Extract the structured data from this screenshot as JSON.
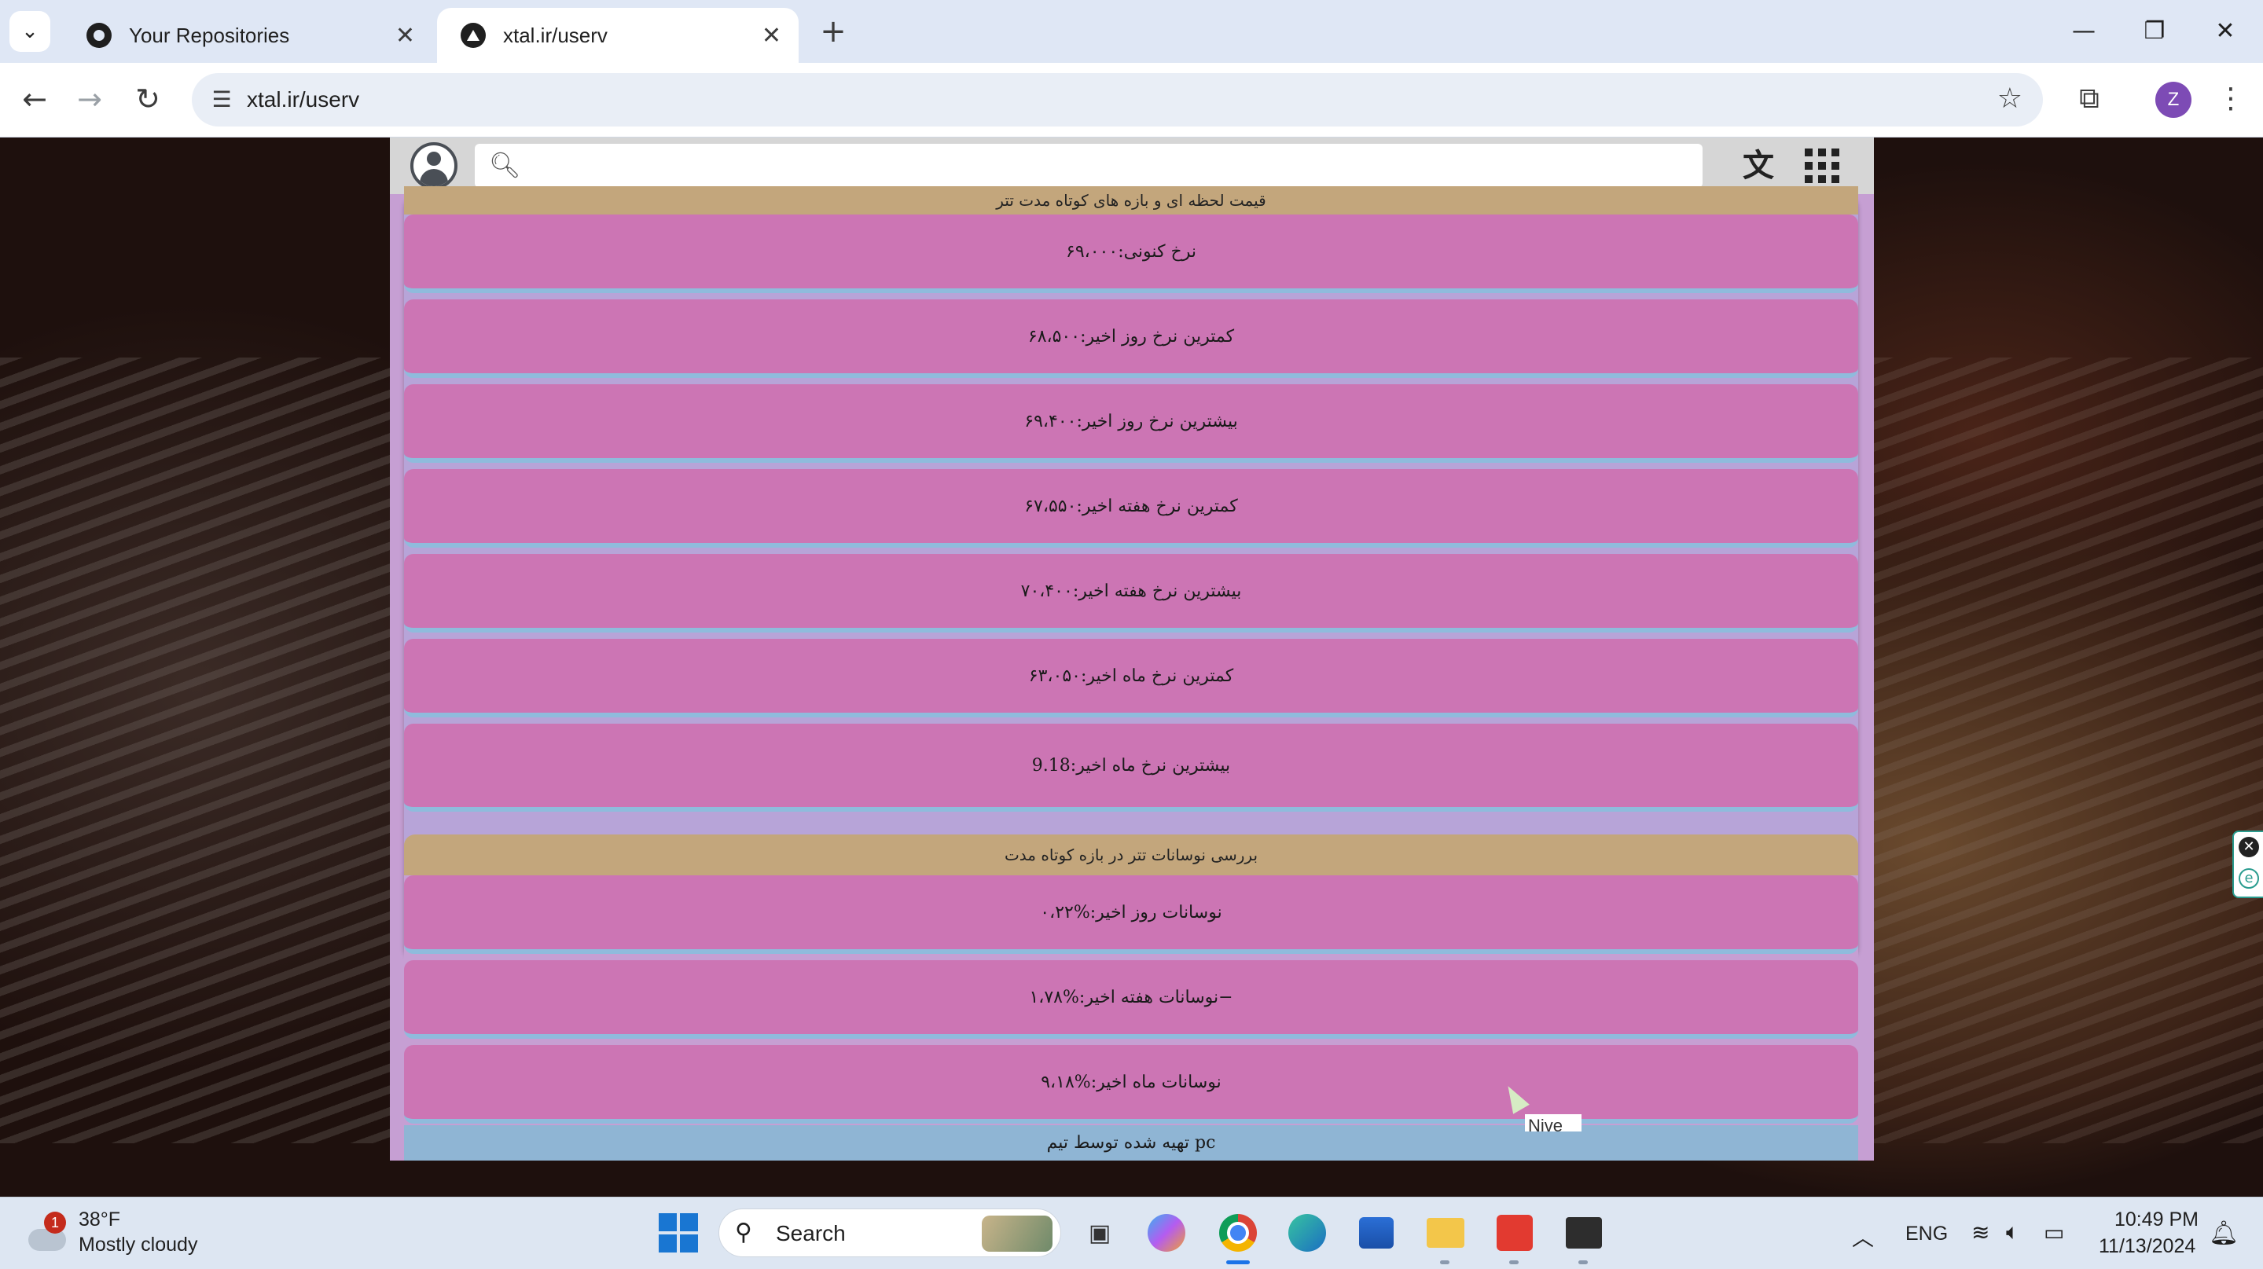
{
  "browser": {
    "tabs": [
      {
        "title": "Your Repositories",
        "active": false
      },
      {
        "title": "xtal.ir/userv",
        "active": true
      }
    ],
    "url": "xtal.ir/userv",
    "profile_initial": "Z"
  },
  "site": {
    "search_placeholder": "",
    "short_term_section": {
      "heading": "قیمت لحظه ای و بازه های کوتاه مدت تتر",
      "rows": [
        "نرخ کنونی:۶۹،۰۰۰",
        "کمترین نرخ روز اخیر:۶۸،۵۰۰",
        "بیشترین نرخ روز اخیر:۶۹،۴۰۰",
        "کمترین نرخ هفته اخیر:۶۷،۵۵۰",
        "بیشترین نرخ هفته اخیر:۷۰،۴۰۰",
        "کمترین نرخ ماه اخیر:۶۳،۰۵۰",
        "بیشترین نرخ ماه اخیر:9.18"
      ]
    },
    "volatility_section": {
      "heading": "بررسی نوسانات تتر در بازه کوتاه مدت",
      "rows": [
        "نوسانات روز اخیر:%۰،۲۲",
        "نوسانات هفته اخیر:%۱،۷۸−",
        "نوسانات ماه اخیر:%۹،۱۸"
      ]
    },
    "footer": "تهیه شده توسط تیم pc",
    "tooltip_fragment": "Nive"
  },
  "taskbar": {
    "weather": {
      "badge": "1",
      "temp": "38°F",
      "desc": "Mostly cloudy"
    },
    "search_label": "Search",
    "language": "ENG",
    "time": "10:49 PM",
    "date": "11/13/2024"
  },
  "colors": {
    "panel": "#c69fd3",
    "row": "#cc75b4",
    "section_head": "#c3a67c",
    "footer": "#8fb5d4"
  }
}
